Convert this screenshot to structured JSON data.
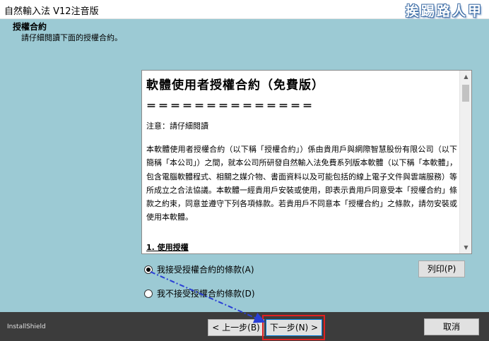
{
  "window": {
    "title": "自然輸入法 V12注音版",
    "watermark": "挨踢路人甲"
  },
  "header": {
    "title": "授權合約",
    "subtitle": "請仔細閱讀下面的授權合約。"
  },
  "license": {
    "heading": "軟體使用者授權合約（免費版）",
    "separator": "＝＝＝＝＝＝＝＝＝＝＝＝＝＝",
    "note": "注意：請仔細閱讀",
    "paragraph": "本軟體使用者授權合約（以下稱「授權合約」）係由貴用戶與網際智慧股份有限公司（以下簡稱「本公司」）之間，就本公司所研發自然輸入法免費系列版本軟體（以下稱「本軟體」，包含電腦軟體程式、相關之媒介物、書面資料以及可能包括的線上電子文件與雲端服務）等所成立之合法協議。本軟體一經貴用戶安裝或使用，即表示貴用戶同意受本「授權合約」條款之約束，同意並遵守下列各項條款。若貴用戶不同意本「授權合約」之條款，請勿安裝或使用本軟體。",
    "section1": "1. 使用授權"
  },
  "options": {
    "accept": "我接受授權合約的條款(A)",
    "decline": "我不接受授權合約條款(D)",
    "selected": "accept"
  },
  "buttons": {
    "print": "列印(P)",
    "back": "< 上一步(B)",
    "next": "下一步(N) >",
    "cancel": "取消"
  },
  "footer": {
    "brand": "InstallShield"
  }
}
